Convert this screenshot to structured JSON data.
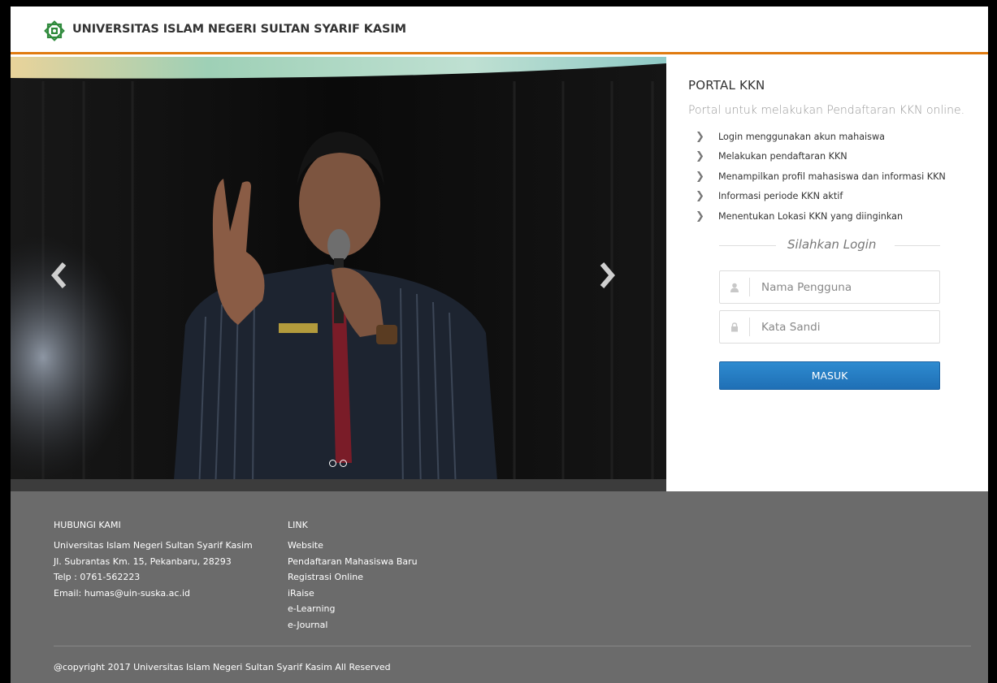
{
  "header": {
    "site_name": "UNIVERSITAS ISLAM NEGERI SULTAN SYARIF KASIM",
    "accent_color": "#e07b10"
  },
  "carousel": {
    "prev_icon": "chevron-left-icon",
    "next_icon": "chevron-right-icon",
    "slide_count": 2
  },
  "portal": {
    "title": "PORTAL KKN",
    "subtitle": "Portal untuk melakukan Pendaftaran KKN online.",
    "features": [
      "Login menggunakan akun mahaiswa",
      "Melakukan pendaftaran KKN",
      "Menampilkan profil mahasiswa dan informasi KKN",
      "Informasi periode KKN aktif",
      "Menentukan Lokasi KKN yang diinginkan"
    ],
    "login_heading": "Silahkan Login",
    "username_placeholder": "Nama Pengguna",
    "password_placeholder": "Kata Sandi",
    "submit_label": "MASUK",
    "button_color": "#2377c2"
  },
  "footer": {
    "contact_heading": "HUBUNGI KAMI",
    "contact_lines": [
      "Universitas Islam Negeri Sultan Syarif Kasim",
      "Jl. Subrantas Km. 15, Pekanbaru, 28293",
      "Telp : 0761-562223",
      "Email: humas@uin-suska.ac.id"
    ],
    "links_heading": "LINK",
    "links": [
      "Website",
      "Pendaftaran Mahasiswa Baru",
      "Registrasi Online",
      "iRaise",
      "e-Learning",
      "e-Journal"
    ],
    "copyright": "@copyright 2017 Universitas Islam Negeri Sultan Syarif Kasim All Reserved"
  }
}
